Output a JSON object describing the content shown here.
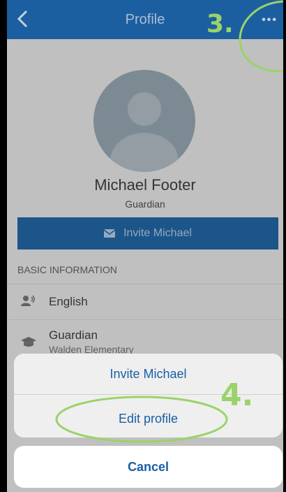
{
  "nav": {
    "title": "Profile",
    "more_label": "•••"
  },
  "profile": {
    "name": "Michael Footer",
    "role": "Guardian",
    "invite_label": "Invite Michael"
  },
  "section": {
    "header": "BASIC INFORMATION"
  },
  "list": [
    {
      "label": "English",
      "icon": "speaker-icon"
    },
    {
      "label": "Guardian",
      "sub": "Walden Elementary",
      "icon": "school-cap-icon"
    }
  ],
  "action_sheet": {
    "items": [
      "Invite Michael",
      "Edit profile"
    ],
    "cancel": "Cancel"
  },
  "annotations": {
    "step3": "3.",
    "step4": "4."
  },
  "colors": {
    "nav": "#1c5fa0",
    "accent": "#1a5ea3",
    "annotation": "#9ad36a"
  }
}
